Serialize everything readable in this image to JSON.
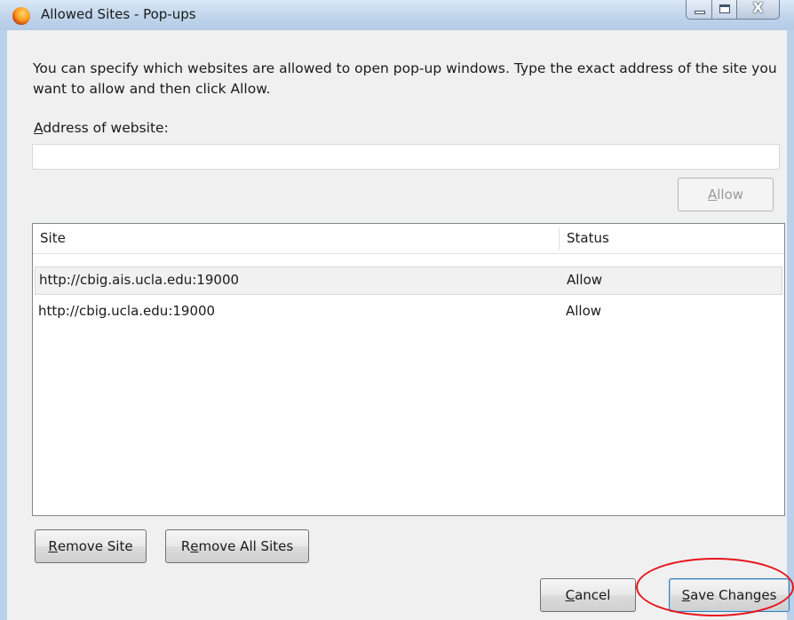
{
  "window": {
    "title": "Allowed Sites - Pop-ups",
    "close_glyph": "X"
  },
  "description": "You can specify which websites are allowed to open pop-up windows. Type the exact address of the site you want to allow and then click Allow.",
  "address": {
    "label_accel": "A",
    "label_rest": "ddress of website:",
    "value": "",
    "placeholder": ""
  },
  "buttons": {
    "allow_accel": "A",
    "allow_rest": "llow",
    "remove_site_accel": "R",
    "remove_site_rest": "emove Site",
    "remove_all_pre": "R",
    "remove_all_accel": "e",
    "remove_all_rest": "move All Sites",
    "cancel_accel": "C",
    "cancel_rest": "ancel",
    "save_accel": "S",
    "save_rest": "ave Changes"
  },
  "list": {
    "columns": {
      "site": "Site",
      "status": "Status"
    },
    "rows": [
      {
        "site": "http://cbig.ais.ucla.edu:19000",
        "status": "Allow"
      },
      {
        "site": "http://cbig.ucla.edu:19000",
        "status": "Allow"
      }
    ]
  },
  "colors": {
    "annotation": "#e8141b",
    "titlebar": "#c2d6ec"
  },
  "icons": {
    "app": "firefox-icon"
  }
}
